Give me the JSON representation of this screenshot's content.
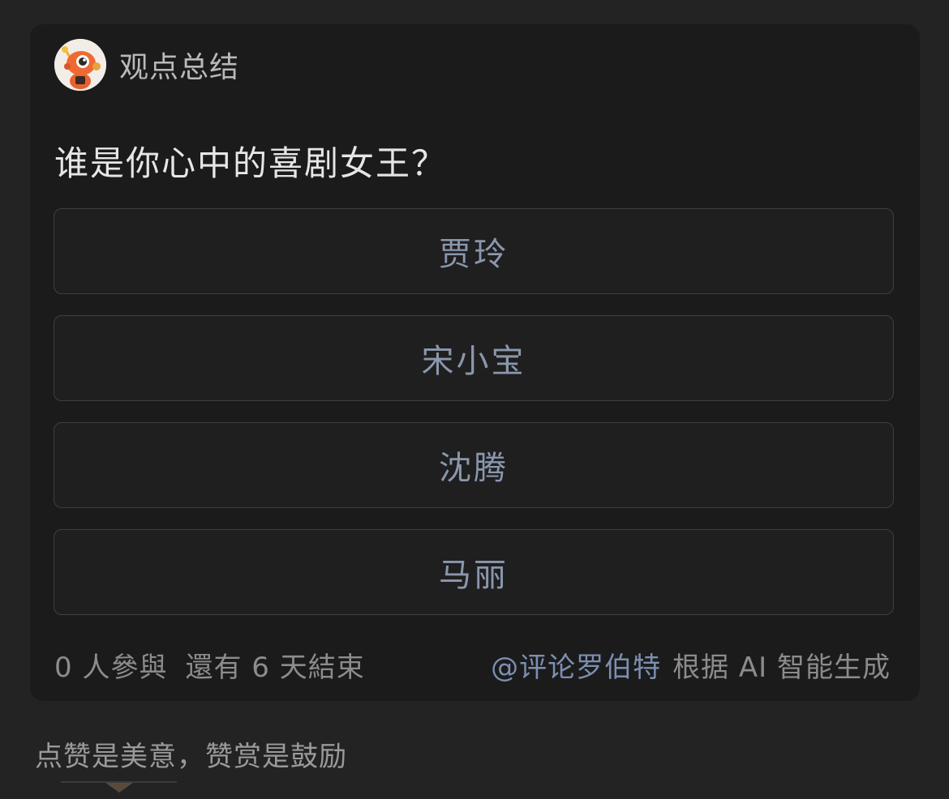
{
  "card": {
    "header_title": "观点总结",
    "avatar_icon": "robot-mascot-avatar",
    "question": "谁是你心中的喜剧女王？",
    "options": [
      {
        "label": "贾玲"
      },
      {
        "label": "宋小宝"
      },
      {
        "label": "沈腾"
      },
      {
        "label": "马丽"
      }
    ],
    "footer": {
      "participants": "0 人參與",
      "remaining": "還有 6 天結束",
      "mention": "@评论罗伯特",
      "generated_note": "根据 AI 智能生成"
    }
  },
  "below_card_text": "点赞是美意，赞赏是鼓励",
  "colors": {
    "background": "#232323",
    "card": "#1b1b1b",
    "option_border": "#3f3f3f",
    "option_text": "#8a97ad",
    "mention": "#7c8fb1"
  }
}
